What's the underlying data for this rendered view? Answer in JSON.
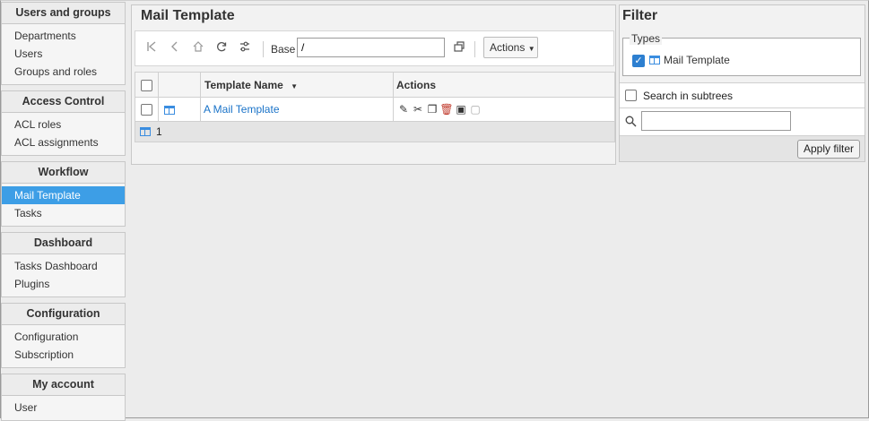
{
  "sidebar": {
    "groups": [
      {
        "title": "Users and groups",
        "items": [
          "Departments",
          "Users",
          "Groups and roles"
        ]
      },
      {
        "title": "Access Control",
        "items": [
          "ACL roles",
          "ACL assignments"
        ]
      },
      {
        "title": "Workflow",
        "items": [
          "Mail Template",
          "Tasks"
        ]
      },
      {
        "title": "Dashboard",
        "items": [
          "Tasks Dashboard",
          "Plugins"
        ]
      },
      {
        "title": "Configuration",
        "items": [
          "Configuration",
          "Subscription"
        ]
      },
      {
        "title": "My account",
        "items": [
          "User"
        ]
      }
    ],
    "active_item": "Mail Template"
  },
  "main": {
    "title": "Mail Template",
    "toolbar": {
      "base_label": "Base",
      "base_value": "/",
      "actions_label": "Actions"
    },
    "table": {
      "columns": [
        "",
        "",
        "Template Name",
        "Actions"
      ],
      "rows": [
        {
          "name": "A Mail Template"
        }
      ],
      "footer_count": "1"
    }
  },
  "filter": {
    "title": "Filter",
    "types_legend": "Types",
    "type_option": "Mail Template",
    "type_checked": true,
    "subtree_label": "Search in subtrees",
    "search_placeholder": "",
    "apply_label": "Apply filter"
  },
  "colors": {
    "active_bg": "#3d9ee6",
    "link": "#1a73c8",
    "checkbox_checked": "#2d7fd0"
  }
}
